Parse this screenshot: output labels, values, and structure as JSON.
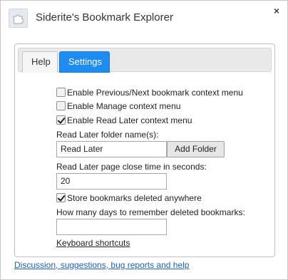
{
  "window": {
    "title": "Siderite's Bookmark Explorer",
    "app_icon": "puzzle-piece-icon",
    "close_glyph": "×"
  },
  "tabs": [
    {
      "label": "Help",
      "active": false
    },
    {
      "label": "Settings",
      "active": true
    }
  ],
  "settings": {
    "prev_next_label": "Enable Previous/Next bookmark context menu",
    "prev_next_checked": false,
    "manage_label": "Enable Manage context menu",
    "manage_checked": false,
    "read_later_label": "Enable Read Later context menu",
    "read_later_checked": true,
    "folder_label": "Read Later folder name(s):",
    "folder_value": "Read Later",
    "add_folder_label": "Add Folder",
    "close_time_label": "Read Later page close time in seconds:",
    "close_time_value": "20",
    "store_deleted_label": "Store bookmarks deleted anywhere",
    "store_deleted_checked": true,
    "days_label": "How many days to remember deleted bookmarks:",
    "days_value": "",
    "keyboard_link": "Keyboard shortcuts"
  },
  "footer": {
    "link": "Discussion, suggestions, bug reports and help"
  },
  "colors": {
    "accent": "#1f8cf2",
    "link": "#1f5fbf"
  }
}
